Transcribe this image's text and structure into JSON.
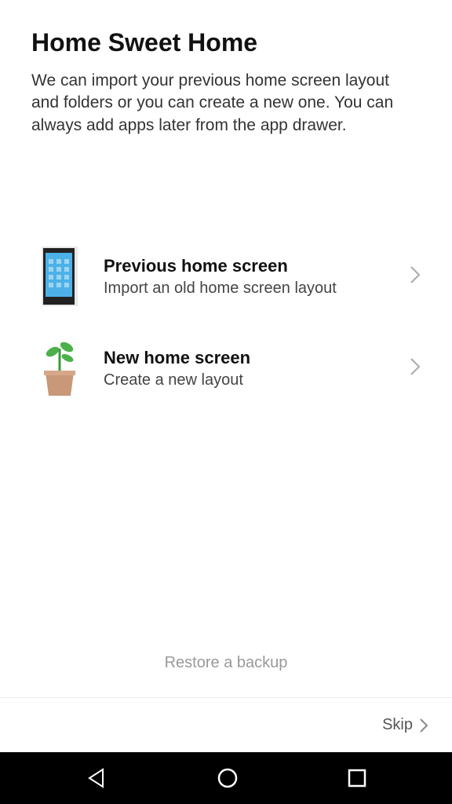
{
  "header": {
    "title": "Home Sweet Home",
    "description": "We can import your previous home screen layout and folders or you can create a new one. You can always add apps later from the app drawer."
  },
  "options": {
    "previous": {
      "title": "Previous home screen",
      "subtitle": "Import an old home screen layout"
    },
    "new": {
      "title": "New home screen",
      "subtitle": "Create a new layout"
    }
  },
  "links": {
    "restore": "Restore a backup",
    "skip": "Skip"
  }
}
